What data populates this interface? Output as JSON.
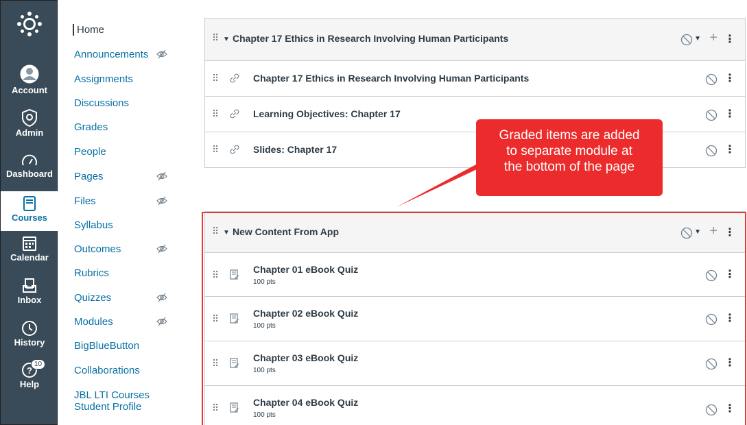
{
  "global_nav": {
    "items": [
      {
        "label": "Account",
        "icon": "account-icon"
      },
      {
        "label": "Admin",
        "icon": "admin-icon"
      },
      {
        "label": "Dashboard",
        "icon": "dashboard-icon"
      },
      {
        "label": "Courses",
        "icon": "courses-icon",
        "active": true
      },
      {
        "label": "Calendar",
        "icon": "calendar-icon"
      },
      {
        "label": "Inbox",
        "icon": "inbox-icon"
      },
      {
        "label": "History",
        "icon": "history-icon"
      },
      {
        "label": "Help",
        "icon": "help-icon",
        "badge": "10"
      }
    ]
  },
  "course_nav": {
    "items": [
      {
        "label": "Home"
      },
      {
        "label": "Announcements",
        "hidden": true
      },
      {
        "label": "Assignments"
      },
      {
        "label": "Discussions"
      },
      {
        "label": "Grades"
      },
      {
        "label": "People"
      },
      {
        "label": "Pages",
        "hidden": true
      },
      {
        "label": "Files",
        "hidden": true
      },
      {
        "label": "Syllabus"
      },
      {
        "label": "Outcomes",
        "hidden": true
      },
      {
        "label": "Rubrics"
      },
      {
        "label": "Quizzes",
        "hidden": true
      },
      {
        "label": "Modules",
        "hidden": true
      },
      {
        "label": "BigBlueButton"
      },
      {
        "label": "Collaborations"
      },
      {
        "label": "JBL LTI Courses Student Profile"
      }
    ]
  },
  "module1": {
    "title": "Chapter 17 Ethics in Research Involving Human Participants",
    "items": [
      {
        "title": "Chapter 17 Ethics in Research Involving Human Participants",
        "icon": "link-icon"
      },
      {
        "title": "Learning Objectives: Chapter 17",
        "icon": "link-icon"
      },
      {
        "title": "Slides: Chapter 17",
        "icon": "link-icon"
      }
    ]
  },
  "module2": {
    "title": "New Content From App",
    "items": [
      {
        "title": "Chapter 01 eBook Quiz",
        "points": "100 pts",
        "icon": "quiz-icon"
      },
      {
        "title": "Chapter 02 eBook Quiz",
        "points": "100 pts",
        "icon": "quiz-icon"
      },
      {
        "title": "Chapter 03 eBook Quiz",
        "points": "100 pts",
        "icon": "quiz-icon"
      },
      {
        "title": "Chapter 04 eBook Quiz",
        "points": "100 pts",
        "icon": "quiz-icon"
      }
    ]
  },
  "callout": {
    "line1": "Graded items are added",
    "line2": "to separate module at",
    "line3": "the bottom of the page"
  },
  "colors": {
    "nav_bg": "#394b58",
    "link": "#0770a3",
    "callout": "#ec2c2c"
  }
}
